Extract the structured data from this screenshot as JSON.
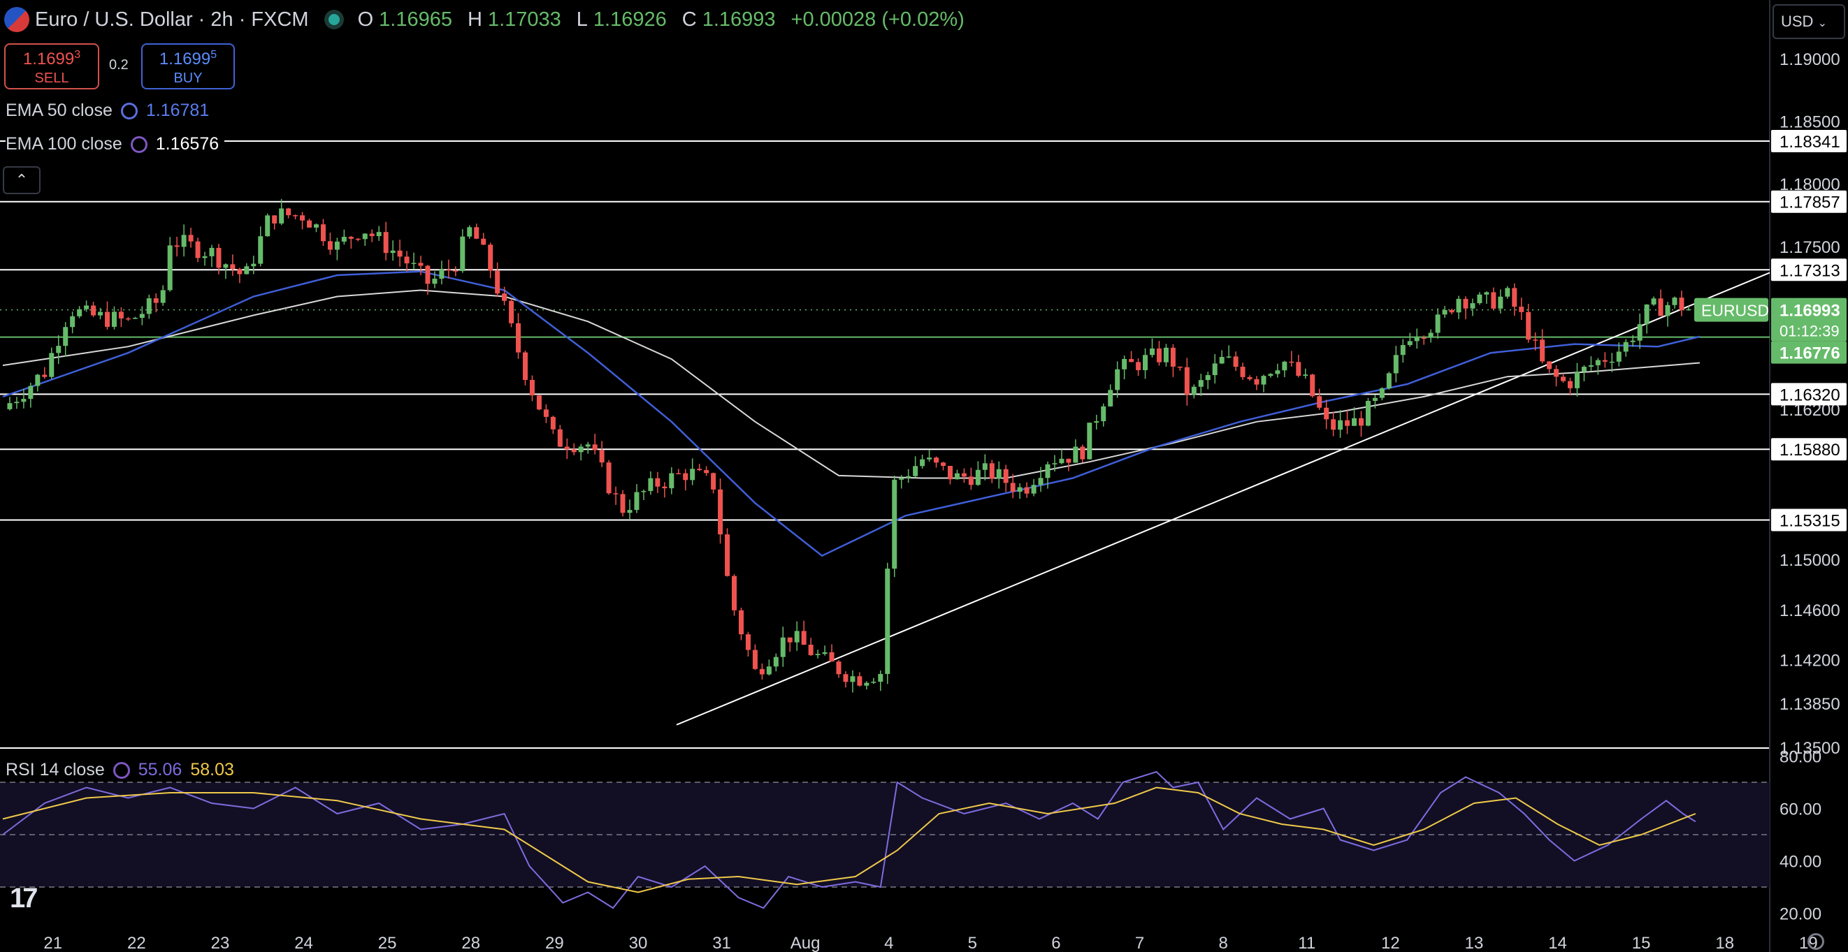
{
  "header": {
    "symbol_title": "Euro / U.S. Dollar · 2h · FXCM",
    "open_label": "O",
    "open": "1.16965",
    "high_label": "H",
    "high": "1.17033",
    "low_label": "L",
    "low": "1.16926",
    "close_label": "C",
    "close": "1.16993",
    "change": "+0.00028 (+0.02%)"
  },
  "trade": {
    "sell_price_main": "1.1699",
    "sell_price_sup": "3",
    "sell_label": "SELL",
    "spread": "0.2",
    "buy_price_main": "1.1699",
    "buy_price_sup": "5",
    "buy_label": "BUY"
  },
  "indicators": {
    "ema50_label": "EMA 50 close",
    "ema50_value": "1.16781",
    "ema100_label": "EMA 100 close",
    "ema100_value": "1.16576",
    "rsi_label": "RSI 14 close",
    "rsi_value": "55.06",
    "rsi_ma_value": "58.03"
  },
  "currency_selector": "USD",
  "colors": {
    "background": "#000000",
    "candle_up": "#66bb6a",
    "candle_down": "#ef5350",
    "ema50": "#3f5fd9",
    "ema100": "#d9d9d9",
    "rsi": "#7e6ce0",
    "rsi_ma": "#f0c94a",
    "level_line": "#ffffff",
    "last_price": "#66bb6a"
  },
  "icons": [
    "flag-icon",
    "market-status-icon",
    "sync-icon",
    "chevron-up-icon",
    "chevron-down-icon",
    "tradingview-logo",
    "settings-icon"
  ],
  "chart_data": [
    {
      "type": "candlestick",
      "symbol_tag": "EURUSD",
      "last_price": "1.16993",
      "countdown": "01:12:39",
      "ylim": [
        1.135,
        1.193
      ],
      "y_ticks": [
        "1.19000",
        "1.18500",
        "1.18000",
        "1.17500",
        "1.16200",
        "1.15000",
        "1.14600",
        "1.14200",
        "1.13850",
        "1.13500"
      ],
      "x_ticks": [
        "21",
        "22",
        "23",
        "24",
        "25",
        "28",
        "29",
        "30",
        "31",
        "Aug",
        "4",
        "5",
        "6",
        "7",
        "8",
        "11",
        "12",
        "13",
        "14",
        "15",
        "18",
        "19"
      ],
      "horizontal_levels": [
        {
          "value": 1.18341,
          "label": "1.18341"
        },
        {
          "value": 1.17857,
          "label": "1.17857"
        },
        {
          "value": 1.17313,
          "label": "1.17313"
        },
        {
          "value": 1.1632,
          "label": "1.16320"
        },
        {
          "value": 1.1588,
          "label": "1.15880"
        },
        {
          "value": 1.15315,
          "label": "1.15315"
        }
      ],
      "ema50_level": {
        "value": 1.16776,
        "label": "1.16776"
      },
      "trendline": [
        {
          "x": "30.9",
          "y": 1.1368
        },
        {
          "x": "19",
          "y": 1.1729
        }
      ],
      "close_path": [
        {
          "x": 0.0,
          "y": 1.162
        },
        {
          "x": 0.5,
          "y": 1.165
        },
        {
          "x": 0.8,
          "y": 1.17
        },
        {
          "x": 1.0,
          "y": 1.1695
        },
        {
          "x": 1.5,
          "y": 1.169
        },
        {
          "x": 1.9,
          "y": 1.1708
        },
        {
          "x": 2.0,
          "y": 1.1755
        },
        {
          "x": 2.5,
          "y": 1.1745
        },
        {
          "x": 2.9,
          "y": 1.1725
        },
        {
          "x": 3.2,
          "y": 1.1775
        },
        {
          "x": 3.6,
          "y": 1.1775
        },
        {
          "x": 4.0,
          "y": 1.175
        },
        {
          "x": 4.3,
          "y": 1.1765
        },
        {
          "x": 4.8,
          "y": 1.174
        },
        {
          "x": 5.1,
          "y": 1.172
        },
        {
          "x": 5.4,
          "y": 1.1735
        },
        {
          "x": 5.6,
          "y": 1.1765
        },
        {
          "x": 5.85,
          "y": 1.173
        },
        {
          "x": 6.0,
          "y": 1.17
        },
        {
          "x": 6.3,
          "y": 1.164
        },
        {
          "x": 6.6,
          "y": 1.1595
        },
        {
          "x": 7.0,
          "y": 1.1592
        },
        {
          "x": 7.4,
          "y": 1.154
        },
        {
          "x": 7.8,
          "y": 1.156
        },
        {
          "x": 8.2,
          "y": 1.157
        },
        {
          "x": 8.5,
          "y": 1.156
        },
        {
          "x": 8.7,
          "y": 1.147
        },
        {
          "x": 9.0,
          "y": 1.141
        },
        {
          "x": 9.4,
          "y": 1.144
        },
        {
          "x": 9.8,
          "y": 1.142
        },
        {
          "x": 10.2,
          "y": 1.1405
        },
        {
          "x": 10.5,
          "y": 1.141
        },
        {
          "x": 10.65,
          "y": 1.156
        },
        {
          "x": 11.0,
          "y": 1.158
        },
        {
          "x": 11.4,
          "y": 1.1565
        },
        {
          "x": 11.8,
          "y": 1.157
        },
        {
          "x": 12.2,
          "y": 1.1555
        },
        {
          "x": 12.5,
          "y": 1.158
        },
        {
          "x": 12.9,
          "y": 1.1585
        },
        {
          "x": 13.3,
          "y": 1.165
        },
        {
          "x": 13.7,
          "y": 1.166
        },
        {
          "x": 13.95,
          "y": 1.1665
        },
        {
          "x": 14.2,
          "y": 1.163
        },
        {
          "x": 14.6,
          "y": 1.166
        },
        {
          "x": 15.0,
          "y": 1.1645
        },
        {
          "x": 15.3,
          "y": 1.166
        },
        {
          "x": 15.6,
          "y": 1.164
        },
        {
          "x": 15.85,
          "y": 1.1605
        },
        {
          "x": 16.2,
          "y": 1.161
        },
        {
          "x": 16.5,
          "y": 1.163
        },
        {
          "x": 16.8,
          "y": 1.168
        },
        {
          "x": 17.2,
          "y": 1.169
        },
        {
          "x": 17.4,
          "y": 1.171
        },
        {
          "x": 17.7,
          "y": 1.1705
        },
        {
          "x": 18.0,
          "y": 1.171
        },
        {
          "x": 18.2,
          "y": 1.169
        },
        {
          "x": 18.45,
          "y": 1.165
        },
        {
          "x": 18.7,
          "y": 1.164
        },
        {
          "x": 19.0,
          "y": 1.1655
        },
        {
          "x": 19.4,
          "y": 1.167
        },
        {
          "x": 19.7,
          "y": 1.17
        },
        {
          "x": 20.0,
          "y": 1.1705
        },
        {
          "x": 20.2,
          "y": 1.1699
        }
      ],
      "ema50_path": [
        {
          "x": 0.0,
          "y": 1.163
        },
        {
          "x": 1.5,
          "y": 1.1665
        },
        {
          "x": 3.0,
          "y": 1.171
        },
        {
          "x": 4.0,
          "y": 1.1727
        },
        {
          "x": 5.0,
          "y": 1.173
        },
        {
          "x": 6.0,
          "y": 1.1715
        },
        {
          "x": 7.0,
          "y": 1.1665
        },
        {
          "x": 8.0,
          "y": 1.161
        },
        {
          "x": 9.0,
          "y": 1.1545
        },
        {
          "x": 9.8,
          "y": 1.1503
        },
        {
          "x": 10.8,
          "y": 1.1535
        },
        {
          "x": 11.8,
          "y": 1.155
        },
        {
          "x": 12.8,
          "y": 1.1565
        },
        {
          "x": 13.8,
          "y": 1.159
        },
        {
          "x": 14.8,
          "y": 1.161
        },
        {
          "x": 15.8,
          "y": 1.1626
        },
        {
          "x": 16.8,
          "y": 1.164
        },
        {
          "x": 17.8,
          "y": 1.1665
        },
        {
          "x": 18.8,
          "y": 1.1672
        },
        {
          "x": 19.8,
          "y": 1.167
        },
        {
          "x": 20.3,
          "y": 1.1678
        }
      ],
      "ema100_path": [
        {
          "x": 0.0,
          "y": 1.1655
        },
        {
          "x": 1.5,
          "y": 1.167
        },
        {
          "x": 3.0,
          "y": 1.1695
        },
        {
          "x": 4.0,
          "y": 1.171
        },
        {
          "x": 5.0,
          "y": 1.1715
        },
        {
          "x": 6.0,
          "y": 1.171
        },
        {
          "x": 7.0,
          "y": 1.169
        },
        {
          "x": 8.0,
          "y": 1.166
        },
        {
          "x": 9.0,
          "y": 1.161
        },
        {
          "x": 10.0,
          "y": 1.1567
        },
        {
          "x": 11.0,
          "y": 1.1565
        },
        {
          "x": 12.0,
          "y": 1.1565
        },
        {
          "x": 13.0,
          "y": 1.1578
        },
        {
          "x": 14.0,
          "y": 1.1593
        },
        {
          "x": 15.0,
          "y": 1.161
        },
        {
          "x": 16.0,
          "y": 1.1618
        },
        {
          "x": 17.0,
          "y": 1.163
        },
        {
          "x": 18.0,
          "y": 1.1646
        },
        {
          "x": 19.0,
          "y": 1.165
        },
        {
          "x": 20.3,
          "y": 1.1657
        }
      ]
    },
    {
      "type": "line",
      "name": "RSI 14 close",
      "ylim": [
        14,
        82
      ],
      "y_ticks": [
        "80.00",
        "60.00",
        "40.00",
        "20.00"
      ],
      "bands": [
        70,
        50,
        30
      ],
      "rsi_path": [
        {
          "x": 0.0,
          "y": 50
        },
        {
          "x": 0.5,
          "y": 62
        },
        {
          "x": 1.0,
          "y": 68
        },
        {
          "x": 1.5,
          "y": 64
        },
        {
          "x": 2.0,
          "y": 68
        },
        {
          "x": 2.5,
          "y": 62
        },
        {
          "x": 3.0,
          "y": 60
        },
        {
          "x": 3.5,
          "y": 68
        },
        {
          "x": 4.0,
          "y": 58
        },
        {
          "x": 4.5,
          "y": 62
        },
        {
          "x": 5.0,
          "y": 52
        },
        {
          "x": 5.5,
          "y": 54
        },
        {
          "x": 6.0,
          "y": 58
        },
        {
          "x": 6.3,
          "y": 38
        },
        {
          "x": 6.7,
          "y": 24
        },
        {
          "x": 7.0,
          "y": 28
        },
        {
          "x": 7.3,
          "y": 22
        },
        {
          "x": 7.6,
          "y": 34
        },
        {
          "x": 8.0,
          "y": 30
        },
        {
          "x": 8.4,
          "y": 38
        },
        {
          "x": 8.8,
          "y": 26
        },
        {
          "x": 9.1,
          "y": 22
        },
        {
          "x": 9.4,
          "y": 34
        },
        {
          "x": 9.8,
          "y": 30
        },
        {
          "x": 10.2,
          "y": 32
        },
        {
          "x": 10.5,
          "y": 30
        },
        {
          "x": 10.7,
          "y": 70
        },
        {
          "x": 11.0,
          "y": 64
        },
        {
          "x": 11.5,
          "y": 58
        },
        {
          "x": 12.0,
          "y": 62
        },
        {
          "x": 12.4,
          "y": 56
        },
        {
          "x": 12.8,
          "y": 62
        },
        {
          "x": 13.1,
          "y": 56
        },
        {
          "x": 13.4,
          "y": 70
        },
        {
          "x": 13.8,
          "y": 74
        },
        {
          "x": 14.0,
          "y": 68
        },
        {
          "x": 14.3,
          "y": 70
        },
        {
          "x": 14.6,
          "y": 52
        },
        {
          "x": 15.0,
          "y": 64
        },
        {
          "x": 15.4,
          "y": 56
        },
        {
          "x": 15.8,
          "y": 60
        },
        {
          "x": 16.0,
          "y": 48
        },
        {
          "x": 16.4,
          "y": 44
        },
        {
          "x": 16.8,
          "y": 48
        },
        {
          "x": 17.2,
          "y": 66
        },
        {
          "x": 17.5,
          "y": 72
        },
        {
          "x": 17.9,
          "y": 66
        },
        {
          "x": 18.2,
          "y": 58
        },
        {
          "x": 18.5,
          "y": 48
        },
        {
          "x": 18.8,
          "y": 40
        },
        {
          "x": 19.2,
          "y": 46
        },
        {
          "x": 19.6,
          "y": 56
        },
        {
          "x": 19.9,
          "y": 63
        },
        {
          "x": 20.1,
          "y": 58
        },
        {
          "x": 20.25,
          "y": 55
        }
      ],
      "rsi_ma_path": [
        {
          "x": 0.0,
          "y": 56
        },
        {
          "x": 1.0,
          "y": 64
        },
        {
          "x": 2.0,
          "y": 66
        },
        {
          "x": 3.0,
          "y": 66
        },
        {
          "x": 4.0,
          "y": 63
        },
        {
          "x": 5.0,
          "y": 56
        },
        {
          "x": 6.0,
          "y": 52
        },
        {
          "x": 6.5,
          "y": 42
        },
        {
          "x": 7.0,
          "y": 32
        },
        {
          "x": 7.6,
          "y": 28
        },
        {
          "x": 8.2,
          "y": 33
        },
        {
          "x": 8.8,
          "y": 34
        },
        {
          "x": 9.5,
          "y": 31
        },
        {
          "x": 10.2,
          "y": 34
        },
        {
          "x": 10.7,
          "y": 44
        },
        {
          "x": 11.2,
          "y": 58
        },
        {
          "x": 11.8,
          "y": 62
        },
        {
          "x": 12.5,
          "y": 58
        },
        {
          "x": 13.3,
          "y": 62
        },
        {
          "x": 13.8,
          "y": 68
        },
        {
          "x": 14.3,
          "y": 66
        },
        {
          "x": 14.8,
          "y": 58
        },
        {
          "x": 15.3,
          "y": 54
        },
        {
          "x": 15.8,
          "y": 52
        },
        {
          "x": 16.4,
          "y": 46
        },
        {
          "x": 17.0,
          "y": 52
        },
        {
          "x": 17.6,
          "y": 62
        },
        {
          "x": 18.1,
          "y": 64
        },
        {
          "x": 18.6,
          "y": 54
        },
        {
          "x": 19.1,
          "y": 46
        },
        {
          "x": 19.6,
          "y": 50
        },
        {
          "x": 20.25,
          "y": 58
        }
      ]
    }
  ]
}
